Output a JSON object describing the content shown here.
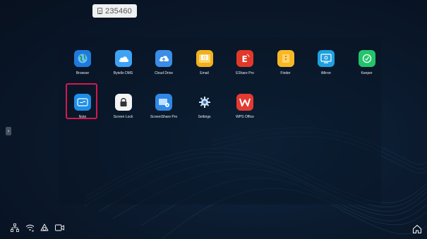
{
  "device": {
    "id": "235460",
    "icon": "sim-card-icon"
  },
  "apps": [
    {
      "label": "Browser",
      "icon": "globe-icon",
      "color": "#1f7ad9"
    },
    {
      "label": "Bytello DMS",
      "icon": "cloud-icon",
      "color": "#3da3f5"
    },
    {
      "label": "Cloud Drive",
      "icon": "cloud-upload-icon",
      "color": "#3a8ee8"
    },
    {
      "label": "Email",
      "icon": "envelope-icon",
      "color": "#f2b01e"
    },
    {
      "label": "EShare Pro",
      "icon": "eshare-icon",
      "color": "#e2382a"
    },
    {
      "label": "Finder",
      "icon": "folder-icon",
      "color": "#f7b826"
    },
    {
      "label": "iMirror",
      "icon": "mirror-icon",
      "color": "#1fa0e0"
    },
    {
      "label": "Keeper",
      "icon": "keeper-icon",
      "color": "#23c46b"
    },
    {
      "label": "Note",
      "icon": "note-icon",
      "color": "#1e8ee8"
    },
    {
      "label": "Screen Lock",
      "icon": "lock-icon",
      "color": "#ffffff"
    },
    {
      "label": "ScreenShare Pro",
      "icon": "screenshare-icon",
      "color": "#2f88e6"
    },
    {
      "label": "Settings",
      "icon": "gear-icon",
      "color": "#2d6fb6"
    },
    {
      "label": "WPS Office",
      "icon": "wps-icon",
      "color": "#e33a32"
    }
  ],
  "selected_app": "Note",
  "status_bar": {
    "icons": [
      "network-icon",
      "wifi-icon",
      "eye-care-icon",
      "screen-record-icon"
    ]
  },
  "home": {
    "icon": "home-icon"
  }
}
